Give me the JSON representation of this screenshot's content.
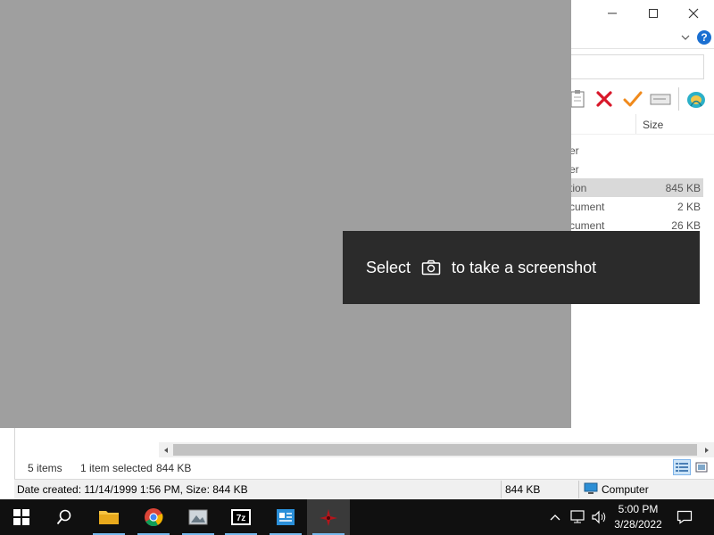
{
  "toast": {
    "before": "Select",
    "after": "to take a screenshot"
  },
  "explorer": {
    "column_header_size": "Size",
    "rows": [
      {
        "type": "er",
        "size": ""
      },
      {
        "type": "er",
        "size": ""
      },
      {
        "type": "tion",
        "size": "845 KB",
        "selected": true
      },
      {
        "type": "cument",
        "size": "2 KB"
      },
      {
        "type": "cument",
        "size": "26 KB"
      }
    ],
    "status": {
      "items": "5 items",
      "selected": "1 item selected",
      "size": "844 KB"
    },
    "statusbar": {
      "details": "Date created: 11/14/1999 1:56 PM, Size: 844 KB",
      "size": "844 KB",
      "location": "Computer"
    }
  },
  "taskbar": {
    "clock_time": "5:00 PM",
    "clock_date": "3/28/2022",
    "apps": [
      "start",
      "search",
      "file-explorer",
      "chrome",
      "image-viewer",
      "7zip",
      "app-window",
      "app-active"
    ]
  },
  "colors": {
    "accent": "#1a6fd1",
    "taskbar": "#101010",
    "overlay": "#9f9f9f",
    "toast": "#2b2b2b"
  }
}
